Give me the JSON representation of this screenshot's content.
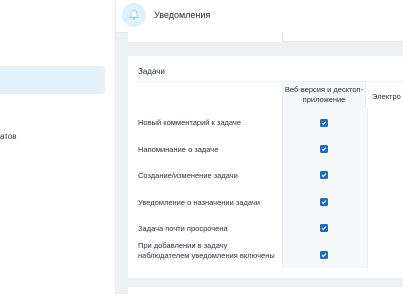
{
  "sidebar": {
    "partial_text": "атов"
  },
  "header": {
    "title": "Уведомления"
  },
  "section": {
    "title": "Задачи",
    "columns": [
      {
        "label": "Веб-версия и десктоп-приложение"
      },
      {
        "label": "Электро"
      }
    ],
    "rows": [
      {
        "label": "Новый комментарий к задаче",
        "checked": true
      },
      {
        "label": "Напоминание о задаче",
        "checked": true
      },
      {
        "label": "Создание/изменение задачи",
        "checked": true
      },
      {
        "label": "Уведомление о назначении задачи",
        "checked": true
      },
      {
        "label": "Задача почти просрочена",
        "checked": true
      },
      {
        "label": "При добавлении в задачу наблюдателем уведомления включены",
        "checked": true
      }
    ]
  },
  "colors": {
    "accent": "#1e6cc8",
    "sidebar_active": "#e4f2fb",
    "background": "#eef1f4"
  }
}
